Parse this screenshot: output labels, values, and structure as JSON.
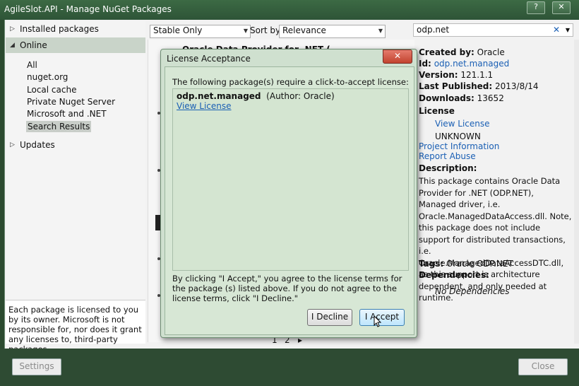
{
  "window": {
    "title": "AgileSlot.API - Manage NuGet Packages",
    "help_label": "?",
    "close_label": "✕"
  },
  "left": {
    "installed": "Installed packages",
    "online": "Online",
    "online_items": [
      "All",
      "nuget.org",
      "Local cache",
      "Private Nuget Server",
      "Microsoft and .NET",
      "Search Results"
    ],
    "updates": "Updates",
    "notice": "Each package is licensed to you by its owner. Microsoft is not responsible for, nor does it grant any licenses to, third-party packages."
  },
  "toolbar": {
    "filter_value": "Stable Only",
    "sort_label": "Sort by:",
    "sort_value": "Relevance"
  },
  "search": {
    "value": "odp.net",
    "clear": "✕"
  },
  "middle": {
    "partial_title": "Oracle Data Provider for .NET (ODP.NET)",
    "page_1": "1",
    "page_2": "2",
    "page_next": "▸"
  },
  "details": {
    "created_by_label": "Created by:",
    "created_by": "Oracle",
    "id_label": "Id:",
    "id": "odp.net.managed",
    "version_label": "Version:",
    "version": "121.1.1",
    "published_label": "Last Published:",
    "published": "2013/8/14",
    "downloads_label": "Downloads:",
    "downloads": "13652",
    "license_label": "License",
    "view_license": "View License",
    "license_type": "UNKNOWN",
    "project_info": "Project Information",
    "report_abuse": "Report Abuse",
    "description_label": "Description:",
    "description": "This package contains Oracle Data Provider for .NET (ODP.NET), Managed driver, i.e. Oracle.ManagedDataAccess.dll. Note, this package does not include support for distributed transactions, i.e. Oracle.ManagedDataAccessDTC.dll, as this support is architecture dependent, and only needed at runtime.",
    "tags_label": "Tags:",
    "tags": "Oracle ODP.NET",
    "dependencies_label": "Dependencies:",
    "dependencies": "No Dependencies"
  },
  "bottom": {
    "settings": "Settings",
    "close": "Close"
  },
  "dialog": {
    "title": "License Acceptance",
    "close": "✕",
    "intro": "The following package(s) require a click-to-accept license:",
    "package_name": "odp.net.managed",
    "package_author": "(Author: Oracle)",
    "view_license": "View License",
    "terms": "By clicking \"I Accept,\" you agree to the license terms for the package (s) listed above. If you do not agree to the license terms, click \"I Decline.\"",
    "decline": "I Decline",
    "accept": "I Accept"
  },
  "colors": {
    "chrome": "#2e5437",
    "dialog_bg": "#cfe0cf",
    "link": "#1a5fb4"
  }
}
